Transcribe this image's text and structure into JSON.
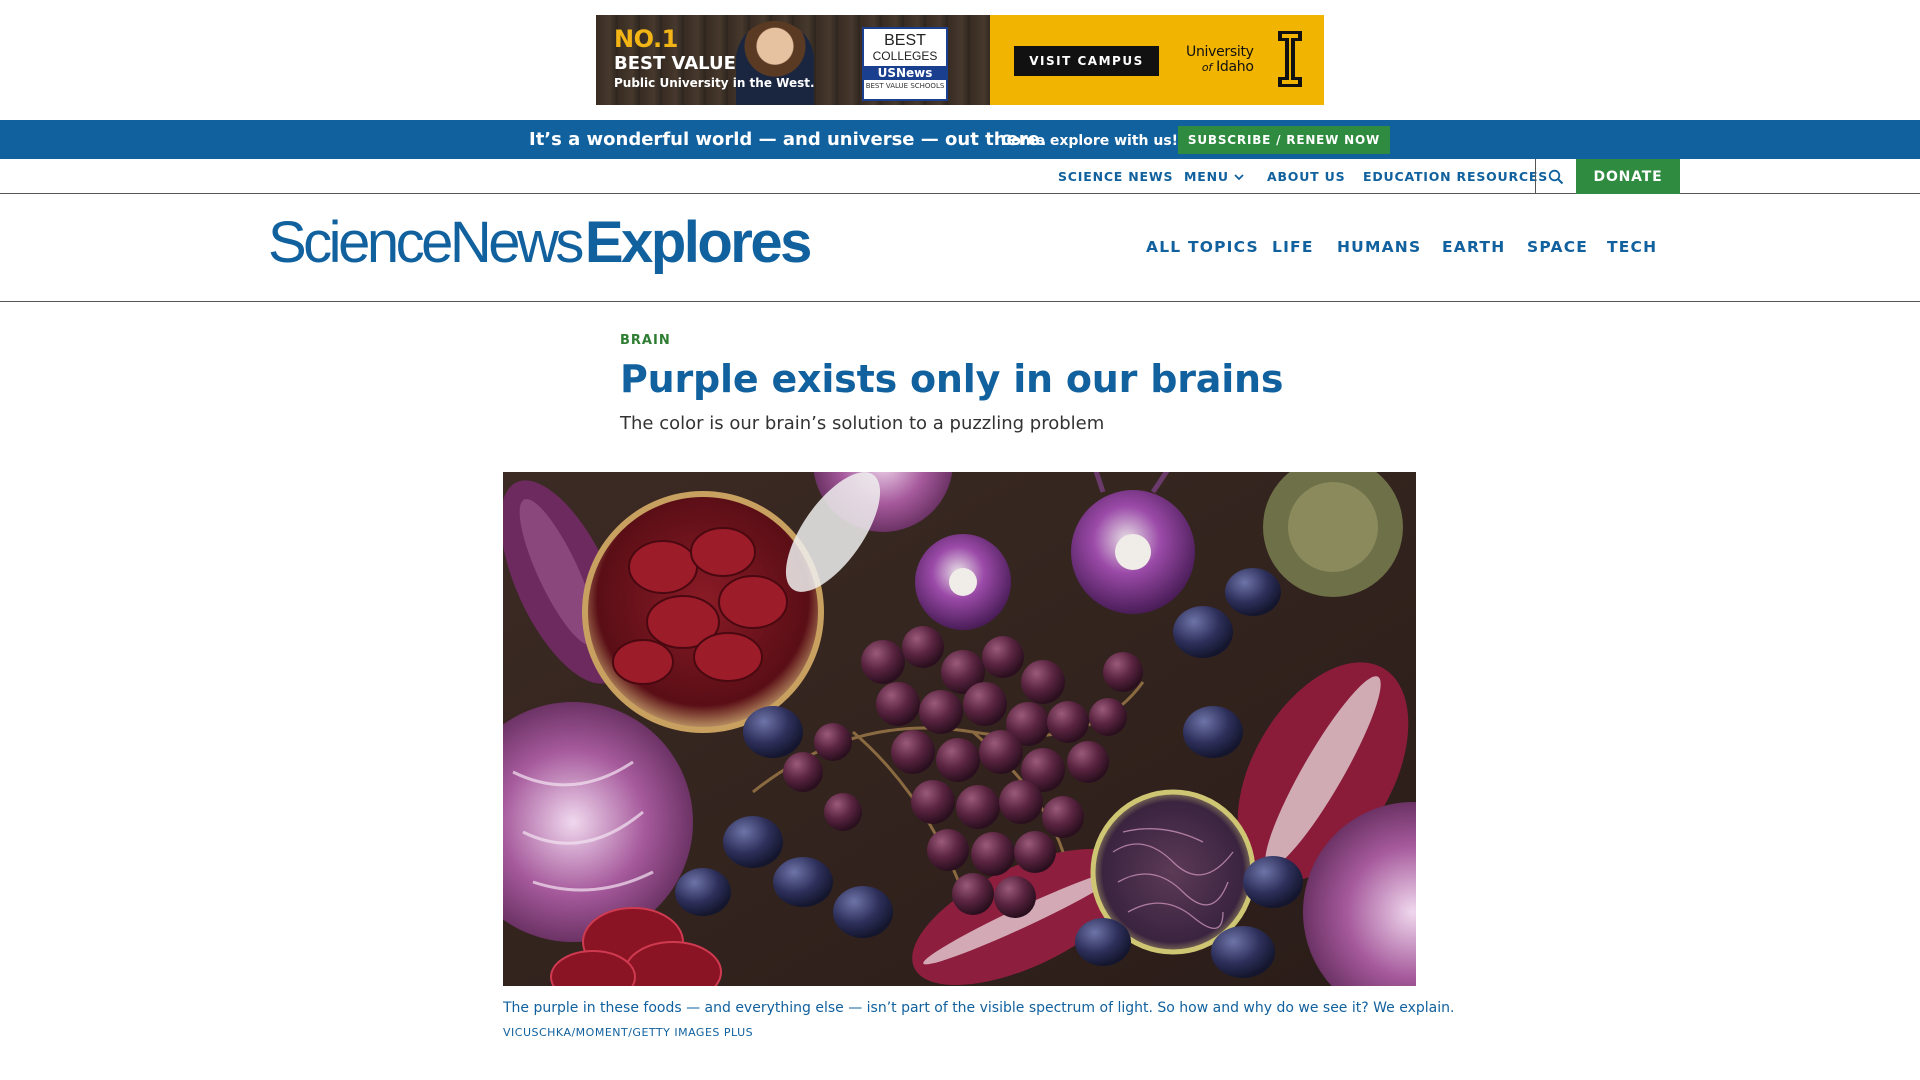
{
  "ad": {
    "headline_no1": "NO.1",
    "headline_best_value": "BEST VALUE",
    "subline": "Public University in the West.",
    "badge_line1": "BEST",
    "badge_line2": "COLLEGES",
    "badge_brand": "USNews",
    "badge_small": "BEST VALUE SCHOOLS",
    "cta_label": "VISIT CAMPUS",
    "brand_line1": "University",
    "brand_line2_of": "of",
    "brand_line2_name": "Idaho",
    "colors": {
      "gold": "#f1b400",
      "dark": "#111111"
    }
  },
  "promo": {
    "main_text": "It’s a wonderful world — and universe — out there.",
    "small_text": "Come explore with us!",
    "button_label": "SUBSCRIBE / RENEW NOW"
  },
  "utility_nav": {
    "items": [
      "SCIENCE NEWS",
      "MENU",
      "ABOUT US",
      "EDUCATION RESOURCES"
    ],
    "search_icon": "search-icon",
    "donate_label": "DONATE"
  },
  "header": {
    "logo_part1": "ScienceNews",
    "logo_part2": "Explores",
    "nav": [
      "ALL TOPICS",
      "LIFE",
      "HUMANS",
      "EARTH",
      "SPACE",
      "TECH"
    ]
  },
  "article": {
    "kicker": "BRAIN",
    "title": "Purple exists only in our brains",
    "dek": "The color is our brain’s solution to a puzzling problem",
    "caption": "The purple in these foods — and everything else — isn’t part of the visible spectrum of light. So how and why do we see it? We explain.",
    "credit": "VICUSCHKA/MOMENT/GETTY IMAGES PLUS"
  },
  "colors": {
    "brand_blue": "#11619e",
    "green": "#2e8b3f",
    "kicker_green": "#2e7d32"
  }
}
